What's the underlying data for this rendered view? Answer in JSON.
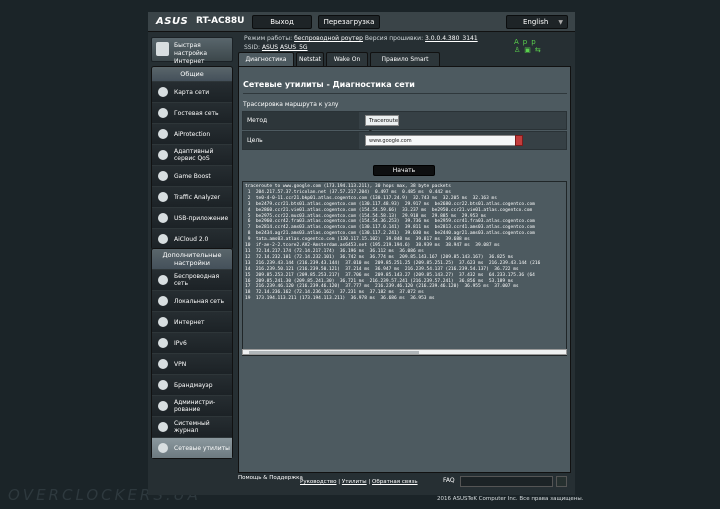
{
  "brand": {
    "logo": "ASUS",
    "model": "RT-AC88U"
  },
  "topbar": {
    "logout": "Выход",
    "reboot": "Перезагрузка",
    "language": "English"
  },
  "status": {
    "mode_label": "Режим работы:",
    "mode_value": "беспроводной роутер",
    "fw_label": "Версия прошивки:",
    "fw_value": "3.0.0.4.380_3141",
    "ssid_label": "SSID:",
    "ssid_1": "ASUS",
    "ssid_2": "ASUS_5G",
    "app_label": "App"
  },
  "quick_setup": "Быстрая настройка Интернет",
  "sidebar": {
    "general_title": "Общие",
    "general_items": [
      {
        "label": "Карта сети",
        "icon": "network-map-icon"
      },
      {
        "label": "Гостевая сеть",
        "icon": "guest-network-icon"
      },
      {
        "label": "AiProtection",
        "icon": "shield-icon"
      },
      {
        "label": "Адаптивный сервис QoS",
        "icon": "qos-icon"
      },
      {
        "label": "Game Boost",
        "icon": "gamepad-icon"
      },
      {
        "label": "Traffic Analyzer",
        "icon": "traffic-analyzer-icon"
      },
      {
        "label": "USB-приложение",
        "icon": "usb-icon"
      },
      {
        "label": "AiCloud 2.0",
        "icon": "cloud-icon"
      }
    ],
    "advanced_title": "Дополнительные настройки",
    "advanced_items": [
      {
        "label": "Беспроводная сеть",
        "icon": "wireless-icon"
      },
      {
        "label": "Локальная сеть",
        "icon": "home-icon"
      },
      {
        "label": "Интернет",
        "icon": "globe-icon"
      },
      {
        "label": "IPv6",
        "icon": "ipv6-icon"
      },
      {
        "label": "VPN",
        "icon": "vpn-icon"
      },
      {
        "label": "Брандмауэр",
        "icon": "firewall-icon"
      },
      {
        "label": "Администри-рование",
        "icon": "admin-icon"
      },
      {
        "label": "Системный журнал",
        "icon": "system-log-icon"
      },
      {
        "label": "Сетевые утилиты",
        "icon": "network-tools-icon",
        "active": true
      }
    ]
  },
  "tabs": [
    "Диагностика сети",
    "Netstat",
    "Wake On LAN",
    "Правило Smart Connect"
  ],
  "page": {
    "title": "Сетевые утилиты - Диагностика сети",
    "section": "Трассировка маршрута к узлу",
    "method_label": "Метод",
    "method_value": "Traceroute",
    "target_label": "Цель",
    "target_value": "www.google.com",
    "start_button": "Начать"
  },
  "output_lines": [
    "traceroute to www.google.com (173.194.113.211), 30 hops max, 38 byte packets",
    " 1  204.217.57.37.tricolan.net (37.57.217.204)  0.497 ms  0.485 ms  0.442 ms",
    " 2  te0-4-0-11.ccr21.bkp01.atlas.cogentco.com (130.117.24.9)  32.743 ms  32.205 ms  32.163 ms",
    " 3  be2479.ccr21.bts01.atlas.cogentco.com (130.117.48.93)  29.917 ms  be2680.ccr22.bts01.atlas.cogentco.com",
    " 4  be2860.ccr21.vie01.atlas.cogentco.com (154.54.59.66)  33.237 ms  be2950.ccr21.vie01.atlas.cogentco.com",
    " 5  be2975.ccr22.muc03.atlas.cogentco.com (154.54.58.13)  29.918 ms  29.885 ms  29.953 ms",
    " 6  be2960.ccr42.fra03.atlas.cogentco.com (154.54.36.253)  39.736 ms  be2959.ccr41.fra03.atlas.cogentco.com",
    " 7  be2814.ccr42.ams03.atlas.cogentco.com (130.117.0.141)  39.811 ms  be2813.ccr41.ams03.atlas.cogentco.com",
    " 8  be2434.agr21.ams03.atlas.cogentco.com (130.117.2.241)  39.030 ms  be2440.agr21.ams03.atlas.cogentco.com",
    " 9  tata.ams03.atlas.cogentco.com (130.117.15.102)  39.848 ms  39.817 ms  39.688 ms",
    "10  if-ae-2-2.tcore2.AV2-Amsterdam.as6453.net (195.219.194.6)  38.939 ms  38.947 ms  39.087 ms",
    "11  72.14.217.174 (72.14.217.174)  36.196 ms  36.112 ms  36.086 ms",
    "12  72.14.232.101 (72.14.232.101)  36.742 ms  36.774 ms  209.85.143.167 (209.85.143.167)  36.825 ms",
    "13  216.239.43.144 (216.239.43.144)  37.010 ms  209.85.251.25 (209.85.251.25)  37.623 ms  216.239.43.144 (216",
    "14  216.239.50.121 (216.239.50.121)  37.214 ms  36.947 ms  216.239.54.137 (216.239.54.137)  36.722 ms",
    "15  209.85.253.217 (209.85.253.217)  37.706 ms  209.85.143.27 (209.85.143.27)  37.432 ms  64.233.175.36 (64",
    "16  209.85.241.30 (209.85.241.30)  36.721 ms  216.239.57.241 (216.239.57.241)  36.856 ms  53.189 ms",
    "17  216.239.46.120 (216.239.46.120)  37.777 ms  216.239.46.120 (216.239.46.120)  36.955 ms  37.007 ms",
    "18  72.14.236.162 (72.14.236.162)  37.231 ms  37.182 ms  37.072 ms",
    "19  173.194.113.211 (173.194.113.211)  36.978 ms  36.686 ms  36.953 ms"
  ],
  "footer": {
    "help": "Помощь & Поддержка",
    "manual": "Руководство",
    "utilities": "Утилиты",
    "feedback": "Обратная связь",
    "faq": "FAQ",
    "copyright": "2016 ASUSTeK Computer Inc. Все права защищены."
  },
  "watermark": "OVERCLOCKERS.UA"
}
